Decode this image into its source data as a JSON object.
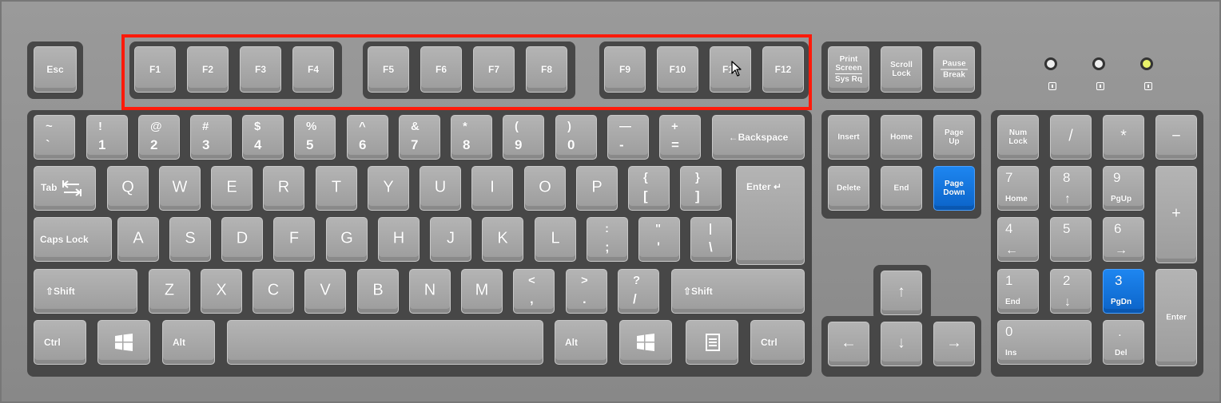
{
  "keys": {
    "esc": "Esc",
    "f1": "F1",
    "f2": "F2",
    "f3": "F3",
    "f4": "F4",
    "f5": "F5",
    "f6": "F6",
    "f7": "F7",
    "f8": "F8",
    "f9": "F9",
    "f10": "F10",
    "f11": "F11",
    "f12": "F12",
    "print_1": "Print",
    "print_2": "Screen",
    "print_3": "Sys Rq",
    "scroll_1": "Scroll",
    "scroll_2": "Lock",
    "pause_1": "Pause",
    "pause_2": "Break",
    "tilde_top": "~",
    "tilde_bot": "`",
    "k1_top": "!",
    "k1_bot": "1",
    "k2_top": "@",
    "k2_bot": "2",
    "k3_top": "#",
    "k3_bot": "3",
    "k4_top": "$",
    "k4_bot": "4",
    "k5_top": "%",
    "k5_bot": "5",
    "k6_top": "^",
    "k6_bot": "6",
    "k7_top": "&",
    "k7_bot": "7",
    "k8_top": "*",
    "k8_bot": "8",
    "k9_top": "(",
    "k9_bot": "9",
    "k0_top": ")",
    "k0_bot": "0",
    "minus_top": "—",
    "minus_bot": "-",
    "equal_top": "+",
    "equal_bot": "=",
    "backspace": "←Backspace",
    "tab": "Tab",
    "q": "Q",
    "w": "W",
    "e": "E",
    "r": "R",
    "t": "T",
    "y": "Y",
    "u": "U",
    "i": "I",
    "o": "O",
    "p": "P",
    "lbracket_top": "{",
    "lbracket_bot": "[",
    "rbracket_top": "}",
    "rbracket_bot": "]",
    "enter": "Enter ↵",
    "capslock": "Caps Lock",
    "a": "A",
    "s": "S",
    "d": "D",
    "f": "F",
    "g": "G",
    "h": "H",
    "j": "J",
    "k": "K",
    "l": "L",
    "semicolon_top": ":",
    "semicolon_bot": ";",
    "quote_top": "\"",
    "quote_bot": "'",
    "backslash_top": "|",
    "backslash_bot": "\\",
    "shift": "⇧Shift",
    "z": "Z",
    "x": "X",
    "c": "C",
    "v": "V",
    "b": "B",
    "n": "N",
    "m": "M",
    "comma_top": "<",
    "comma_bot": ",",
    "period_top": ">",
    "period_bot": ".",
    "slash_top": "?",
    "slash_bot": "/",
    "ctrl": "Ctrl",
    "alt": "Alt",
    "insert": "Insert",
    "home": "Home",
    "pageup_1": "Page",
    "pageup_2": "Up",
    "delete": "Delete",
    "end": "End",
    "pagedown_1": "Page",
    "pagedown_2": "Down",
    "arrow_up": "↑",
    "arrow_left": "←",
    "arrow_down": "↓",
    "arrow_right": "→",
    "numlock_1": "Num",
    "numlock_2": "Lock",
    "np_slash": "/",
    "np_star": "*",
    "np_minus": "−",
    "np_plus": "+",
    "np_enter": "Enter",
    "np7": "7",
    "np7_sub": "Home",
    "np8": "8",
    "np8_sub": "↑",
    "np9": "9",
    "np9_sub": "PgUp",
    "np4": "4",
    "np4_sub": "←",
    "np5": "5",
    "np6": "6",
    "np6_sub": "→",
    "np1": "1",
    "np1_sub": "End",
    "np2": "2",
    "np2_sub": "↓",
    "np3": "3",
    "np3_sub": "PgDn",
    "np0": "0",
    "np0_sub": "Ins",
    "npdot": ".",
    "npdot_sub": "Del"
  },
  "icons": {
    "windows": "windows-logo-icon",
    "menu": "context-menu-icon",
    "tab_arrows": "tab-arrows-icon",
    "cursor": "mouse-pointer-icon",
    "lock": "lock-icon"
  },
  "indicators": [
    "off",
    "off",
    "on"
  ],
  "highlight_color": "#ff1a0a",
  "accent_key_color": "#1a7fe8"
}
